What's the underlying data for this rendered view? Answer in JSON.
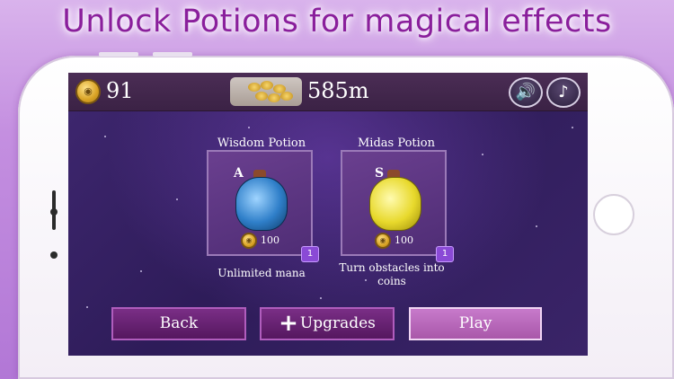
{
  "headline": "Unlock Potions for magical effects",
  "hud": {
    "coins": "91",
    "distance": "585m",
    "sound_icon": "speaker-icon",
    "music_icon": "music-note-icon"
  },
  "potions": [
    {
      "title": "Wisdom Potion",
      "letter": "A",
      "price": "100",
      "count": "1",
      "description": "Unlimited mana",
      "color": "#2f7fc9"
    },
    {
      "title": "Midas Potion",
      "letter": "S",
      "price": "100",
      "count": "1",
      "description": "Turn obstacles into coins",
      "color": "#e8d92c"
    }
  ],
  "buttons": {
    "back": "Back",
    "upgrades": "Upgrades",
    "play": "Play"
  }
}
